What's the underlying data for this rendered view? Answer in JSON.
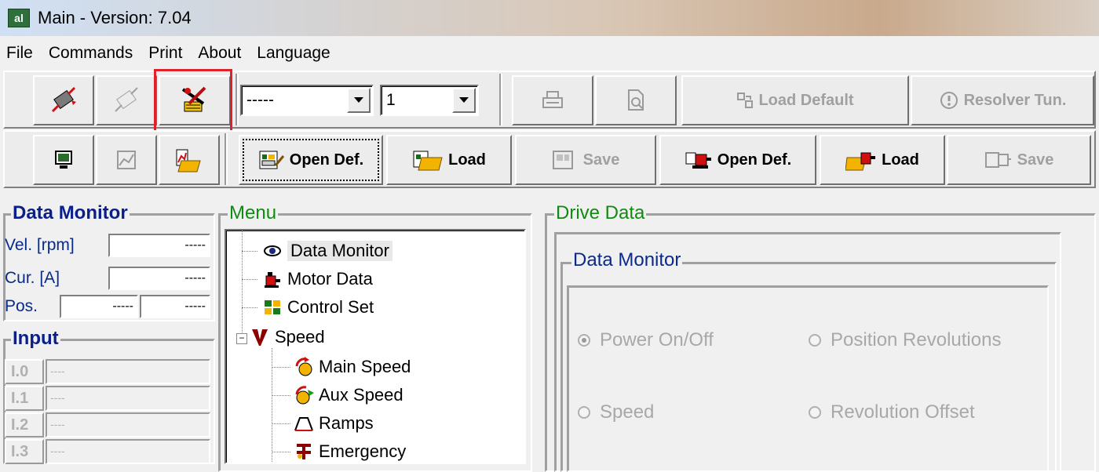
{
  "window": {
    "title": "Main - Version: 7.04",
    "app_icon_text": "al"
  },
  "menu": [
    "File",
    "Commands",
    "Print",
    "About",
    "Language"
  ],
  "toolbar1": {
    "combo1_value": "-----",
    "combo2_value": "1",
    "load_default_label": "Load Default",
    "resolver_label": "Resolver Tun."
  },
  "toolbar2": {
    "open_def_label": "Open Def.",
    "load_label": "Load",
    "save_label": "Save",
    "motor_open_def_label": "Open Def.",
    "motor_load_label": "Load",
    "motor_save_label": "Save"
  },
  "data_monitor": {
    "title": "Data Monitor",
    "vel_label": "Vel. [rpm]",
    "vel_value": "-----",
    "cur_label": "Cur. [A]",
    "cur_value": "-----",
    "pos_label": "Pos.",
    "pos_value1": "-----",
    "pos_value2": "-----"
  },
  "input": {
    "title": "Input",
    "rows": [
      {
        "label": "I.0",
        "value": "----"
      },
      {
        "label": "I.1",
        "value": "----"
      },
      {
        "label": "I.2",
        "value": "----"
      },
      {
        "label": "I.3",
        "value": "----"
      }
    ]
  },
  "menu_panel": {
    "title": "Menu",
    "items": [
      "Data Monitor",
      "Motor Data",
      "Control Set",
      "Speed",
      "Main Speed",
      "Aux Speed",
      "Ramps",
      "Emergency"
    ]
  },
  "drive_data": {
    "title": "Drive Data",
    "inner_title": "Data Monitor",
    "radios": [
      "Power On/Off",
      "Position Revolutions",
      "Speed",
      "Revolution Offset"
    ]
  }
}
